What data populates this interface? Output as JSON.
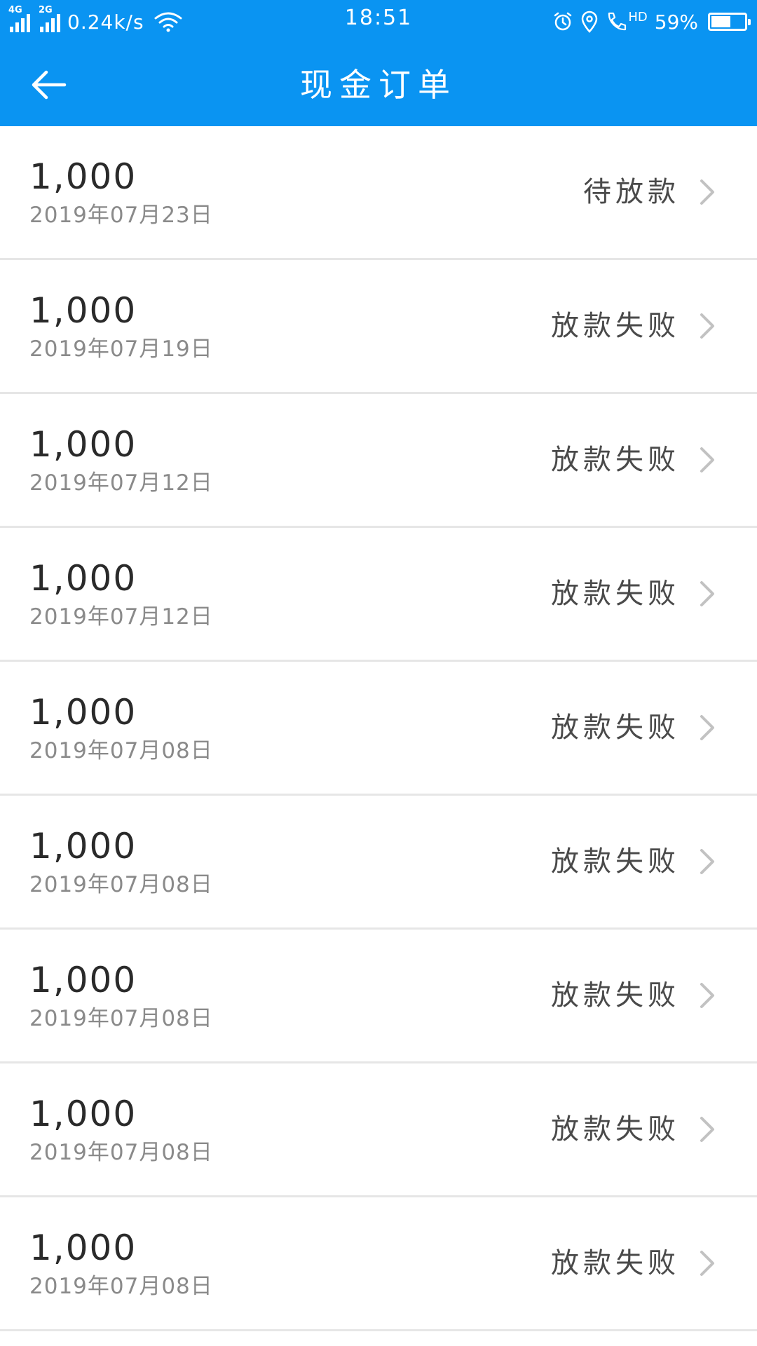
{
  "status_bar": {
    "signal_1_tag": "4G",
    "signal_2_tag": "2G",
    "net_speed": "0.24k/s",
    "time": "18:51",
    "hd_tag": "HD",
    "battery_percent_text": "59%",
    "battery_level": 0.59
  },
  "header": {
    "title": "现金订单"
  },
  "orders": [
    {
      "amount": "1,000",
      "date": "2019年07月23日",
      "status": "待放款"
    },
    {
      "amount": "1,000",
      "date": "2019年07月19日",
      "status": "放款失败"
    },
    {
      "amount": "1,000",
      "date": "2019年07月12日",
      "status": "放款失败"
    },
    {
      "amount": "1,000",
      "date": "2019年07月12日",
      "status": "放款失败"
    },
    {
      "amount": "1,000",
      "date": "2019年07月08日",
      "status": "放款失败"
    },
    {
      "amount": "1,000",
      "date": "2019年07月08日",
      "status": "放款失败"
    },
    {
      "amount": "1,000",
      "date": "2019年07月08日",
      "status": "放款失败"
    },
    {
      "amount": "1,000",
      "date": "2019年07月08日",
      "status": "放款失败"
    },
    {
      "amount": "1,000",
      "date": "2019年07月08日",
      "status": "放款失败"
    }
  ],
  "colors": {
    "header_bg": "#0a94f2",
    "amount_text": "#2a2a2a",
    "date_text": "#8a8a8a",
    "status_text": "#4a4a4a",
    "divider": "#e6e6e6"
  },
  "icons": {
    "back": "arrow-left-icon",
    "chevron": "chevron-right-icon",
    "wifi": "wifi-icon",
    "alarm": "alarm-clock-icon",
    "location": "location-pin-icon",
    "call": "phone-call-icon",
    "battery": "battery-icon"
  }
}
